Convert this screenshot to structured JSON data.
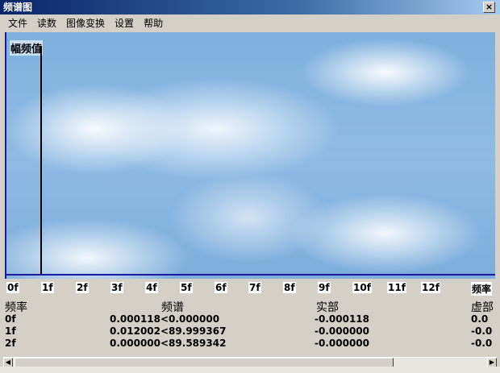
{
  "window": {
    "title": "频谱图",
    "close": "×"
  },
  "menu": [
    "文件",
    "读数",
    "图像变换",
    "设置",
    "帮助"
  ],
  "chart": {
    "ylabel": "幅频值",
    "xlabel": "频率",
    "ticks": [
      "0f",
      "1f",
      "2f",
      "3f",
      "4f",
      "5f",
      "6f",
      "7f",
      "8f",
      "9f",
      "10f",
      "11f",
      "12f"
    ]
  },
  "table": {
    "headers": [
      "频率",
      "频谱",
      "实部",
      "虚部"
    ],
    "rows": [
      {
        "freq": "0f",
        "spectrum": "0.000118<0.000000",
        "real": "-0.000118",
        "imag": "0.0"
      },
      {
        "freq": "1f",
        "spectrum": "0.012002<89.999367",
        "real": "-0.000000",
        "imag": "-0.0"
      },
      {
        "freq": "2f",
        "spectrum": "0.000000<89.589342",
        "real": "-0.000000",
        "imag": "-0.0"
      }
    ]
  },
  "colors": {
    "axis": "#1a1aa0",
    "titlebar": "#0a246a"
  }
}
